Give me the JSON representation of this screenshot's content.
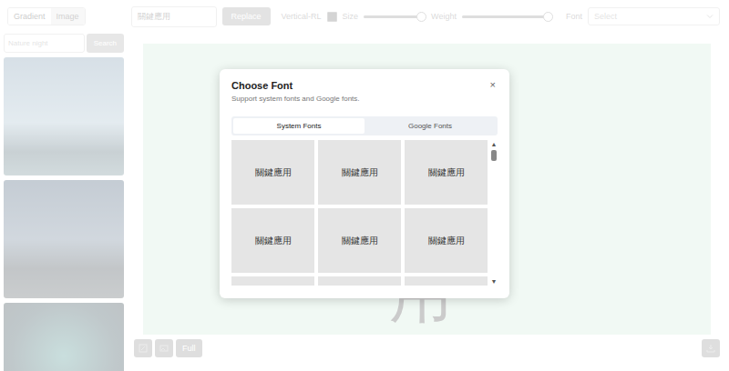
{
  "toolbar": {
    "mode_tabs": [
      {
        "label": "Gradient",
        "selected": true
      },
      {
        "label": "Image",
        "selected": false
      }
    ],
    "text_field": {
      "value": "關鍵應用"
    },
    "replace_button": "Replace",
    "vertical": {
      "label": "Vertical-RL",
      "checked": true
    },
    "size": {
      "label": "Size",
      "level": 0.92
    },
    "weight": {
      "label": "Weight",
      "level": 1.0
    },
    "font": {
      "label": "Font",
      "placeholder": "Select"
    }
  },
  "sidebar": {
    "search": {
      "placeholder": "Nature night",
      "button": "Search"
    }
  },
  "canvas": {
    "text": "用"
  },
  "footer": {
    "full_button": "Full"
  },
  "modal": {
    "title": "Choose Font",
    "subtitle": "Support system fonts and Google fonts.",
    "close": "×",
    "tabs": [
      {
        "label": "System Fonts",
        "selected": true
      },
      {
        "label": "Google Fonts",
        "selected": false
      }
    ],
    "fonts": [
      {
        "label": "關鍵應用"
      },
      {
        "label": "關鍵應用"
      },
      {
        "label": "關鍵應用"
      },
      {
        "label": "關鍵應用"
      },
      {
        "label": "關鍵應用"
      },
      {
        "label": "關鍵應用"
      },
      {
        "label": ""
      },
      {
        "label": ""
      },
      {
        "label": ""
      }
    ],
    "scrollbar": {
      "up": "▲",
      "down": "▼",
      "position": 0
    }
  }
}
